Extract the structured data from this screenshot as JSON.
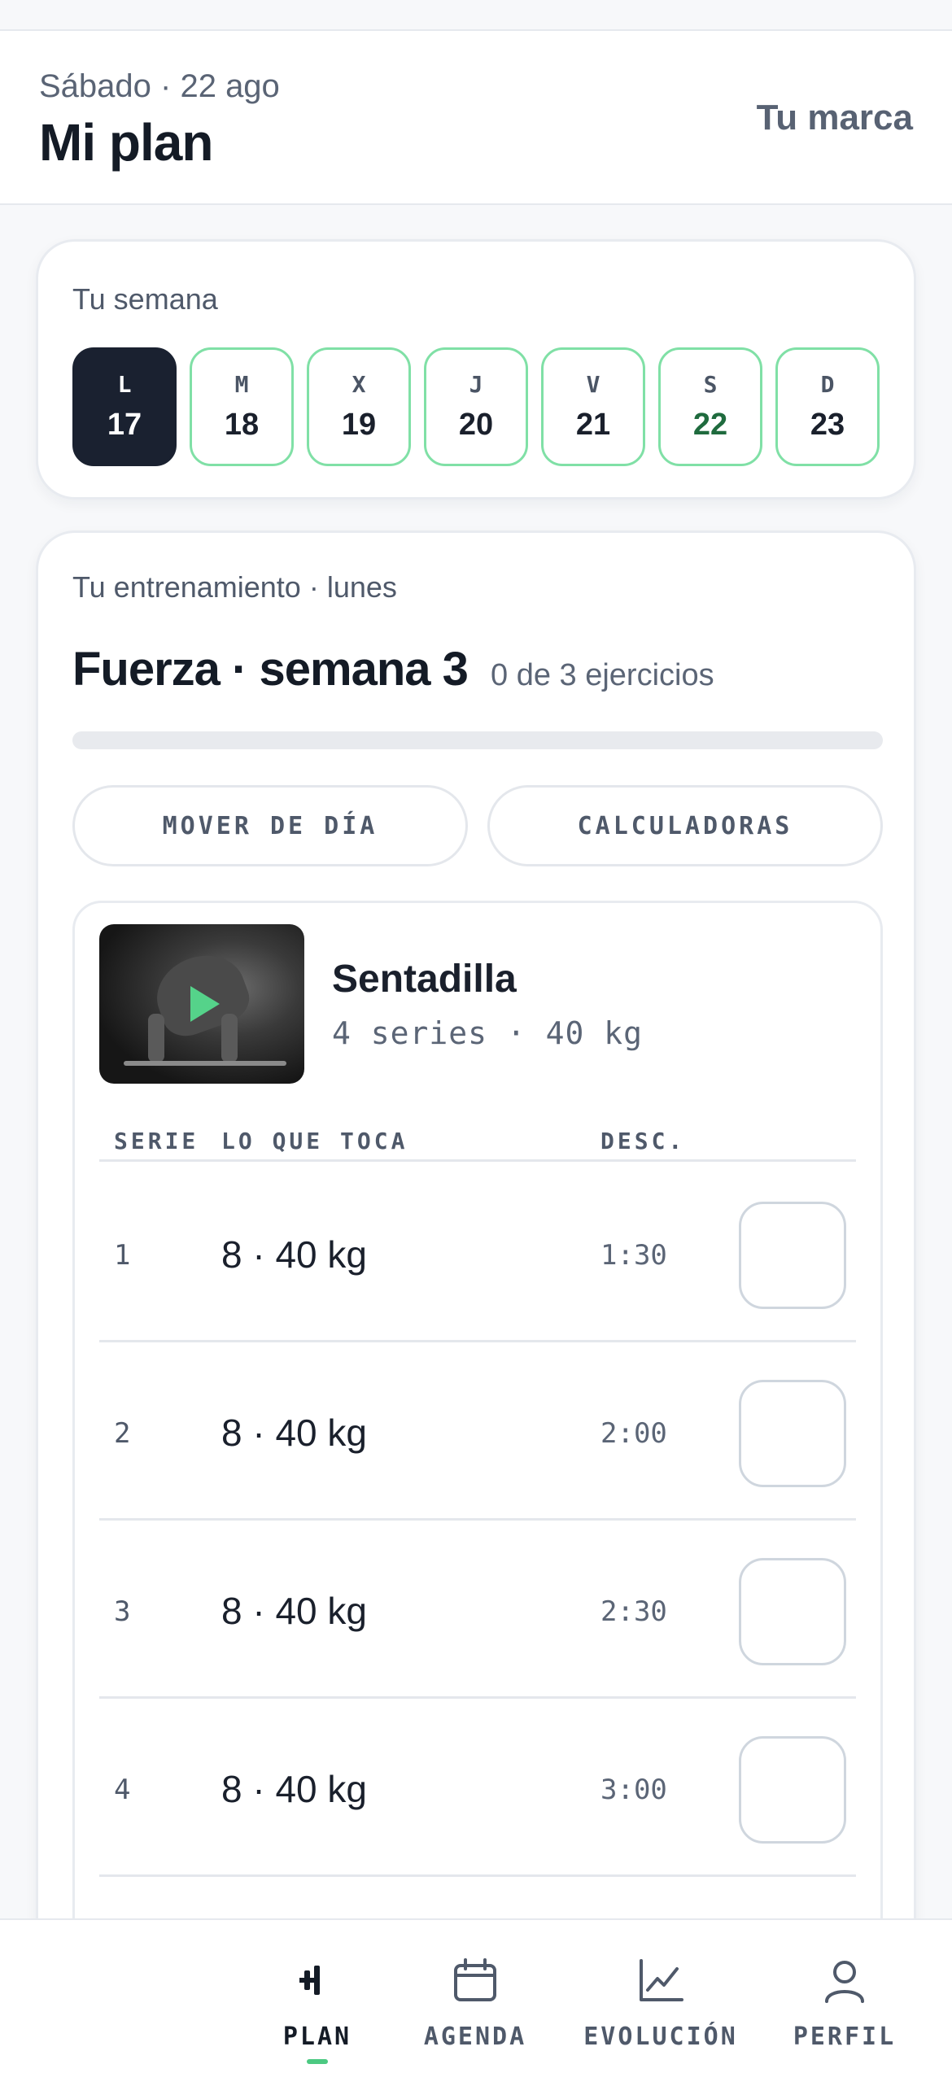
{
  "header": {
    "date": "Sábado · 22 ago",
    "title": "Mi plan",
    "brand_link": "Tu marca"
  },
  "week": {
    "label": "Tu semana",
    "days": [
      {
        "letter": "L",
        "num": "17",
        "state": "selected"
      },
      {
        "letter": "M",
        "num": "18",
        "state": "normal"
      },
      {
        "letter": "X",
        "num": "19",
        "state": "normal"
      },
      {
        "letter": "J",
        "num": "20",
        "state": "normal"
      },
      {
        "letter": "V",
        "num": "21",
        "state": "normal"
      },
      {
        "letter": "S",
        "num": "22",
        "state": "today"
      },
      {
        "letter": "D",
        "num": "23",
        "state": "normal"
      }
    ]
  },
  "training": {
    "label": "Tu entrenamiento · lunes",
    "title": "Fuerza · semana 3",
    "count": "0 de 3 ejercicios",
    "progress": 0,
    "actions": {
      "move": "MOVER DE DÍA",
      "calc": "CALCULADORAS"
    },
    "exercise": {
      "name": "Sentadilla",
      "meta": "4 series · 40 kg",
      "headers": {
        "serie": "SERIE",
        "load": "LO QUE TOCA",
        "rest": "DESC."
      },
      "rows": [
        {
          "serie": "1",
          "load": "8 · 40 kg",
          "rest": "1:30"
        },
        {
          "serie": "2",
          "load": "8 · 40 kg",
          "rest": "2:00"
        },
        {
          "serie": "3",
          "load": "8 · 40 kg",
          "rest": "2:30"
        },
        {
          "serie": "4",
          "load": "8 · 40 kg",
          "rest": "3:00"
        }
      ]
    }
  },
  "nav": {
    "plan": "PLAN",
    "agenda": "AGENDA",
    "evolucion": "EVOLUCIÓN",
    "perfil": "PERFIL",
    "active": "plan"
  },
  "colors": {
    "accent": "#4cc982",
    "dark": "#1a2130",
    "day_border": "#80e0a6",
    "today_text": "#1f6b3e"
  }
}
